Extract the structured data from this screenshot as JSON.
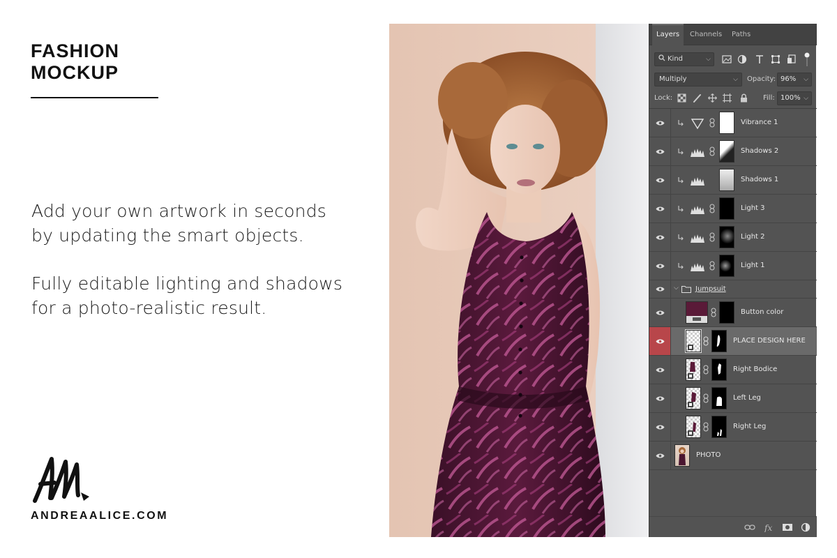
{
  "promo": {
    "title_line1": "FASHION",
    "title_line2": "MOCKUP",
    "paragraph1_line1": "Add your own artwork in seconds",
    "paragraph1_line2": "by updating the smart objects.",
    "paragraph2_line1": "Fully editable lighting and shadows",
    "paragraph2_line2": "for a photo-realistic result.",
    "logo_letters": "AA",
    "website": "ANDREAALICE.COM"
  },
  "photo": {
    "icon": "model-photo-jumpsuit"
  },
  "layers_panel": {
    "tabs": [
      {
        "label": "Layers",
        "active": true
      },
      {
        "label": "Channels",
        "active": false
      },
      {
        "label": "Paths",
        "active": false
      }
    ],
    "filter_kind": "Kind",
    "blend_mode": "Multiply",
    "opacity_label": "Opacity:",
    "opacity_value": "96%",
    "lock_label": "Lock:",
    "fill_label": "Fill:",
    "fill_value": "100%",
    "layers": [
      {
        "name": "Vibrance 1",
        "type": "adjustment",
        "icon": "vibrance-icon",
        "clipped": true
      },
      {
        "name": "Shadows 2",
        "type": "adjustment",
        "icon": "levels-icon",
        "clipped": true
      },
      {
        "name": "Shadows 1",
        "type": "adjustment",
        "icon": "levels-icon",
        "clipped": true
      },
      {
        "name": "Light 3",
        "type": "adjustment",
        "icon": "levels-icon",
        "clipped": true
      },
      {
        "name": "Light 2",
        "type": "adjustment",
        "icon": "levels-icon",
        "clipped": true
      },
      {
        "name": "Light 1",
        "type": "adjustment",
        "icon": "levels-icon",
        "clipped": true
      },
      {
        "name": "Jumpsuit",
        "type": "group",
        "icon": "folder-icon"
      },
      {
        "name": "Button color",
        "type": "fill",
        "color": "#5a1a38"
      },
      {
        "name": "PLACE DESIGN HERE",
        "type": "smart-object",
        "selected": true
      },
      {
        "name": "Right Bodice",
        "type": "smart-object"
      },
      {
        "name": "Left Leg",
        "type": "smart-object"
      },
      {
        "name": "Right Leg",
        "type": "smart-object"
      },
      {
        "name": "PHOTO",
        "type": "image"
      }
    ],
    "bottom_icons": [
      "link-layers-icon",
      "fx-icon",
      "mask-icon",
      "adjustment-layer-icon"
    ]
  },
  "colors": {
    "panel_bg": "#535353",
    "selected_eye": "#b8464a",
    "selected_row": "#6a6a6a",
    "button_color_swatch": "#5a1a38"
  }
}
